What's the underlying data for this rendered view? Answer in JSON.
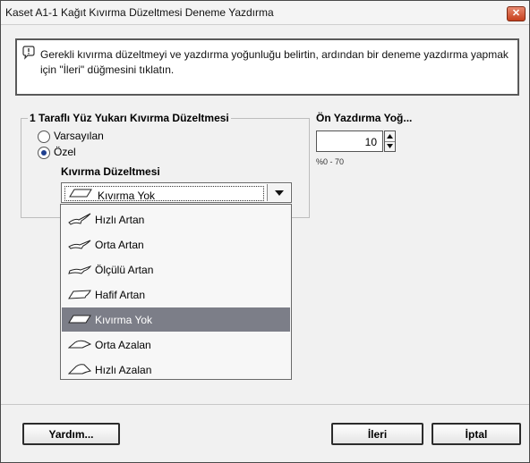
{
  "window": {
    "title": "Kaset A1-1 Kağıt Kıvırma Düzeltmesi Deneme Yazdırma",
    "close_label": "✕"
  },
  "info": {
    "icon": "speech-bubble-info-icon",
    "text": "Gerekli kıvırma düzeltmeyi ve yazdırma yoğunluğu belirtin, ardından bir deneme yazdırma yapmak için \"İleri\" düğmesini tıklatın."
  },
  "curl_group": {
    "title": "1 Taraflı Yüz Yukarı Kıvırma Düzeltmesi",
    "options": [
      {
        "label": "Varsayılan",
        "checked": false
      },
      {
        "label": "Özel",
        "checked": true
      }
    ],
    "sub_label": "Kıvırma Düzeltmesi",
    "selected_value": "Kıvırma Yok",
    "dropdown_items": [
      {
        "label": "Hızlı Artan",
        "icon": "curl-up-strong-icon",
        "selected": false
      },
      {
        "label": "Orta Artan",
        "icon": "curl-up-medium-icon",
        "selected": false
      },
      {
        "label": "Ölçülü Artan",
        "icon": "curl-up-moderate-icon",
        "selected": false
      },
      {
        "label": "Hafif Artan",
        "icon": "curl-up-light-icon",
        "selected": false
      },
      {
        "label": "Kıvırma Yok",
        "icon": "flat-paper-icon",
        "selected": true
      },
      {
        "label": "Orta Azalan",
        "icon": "curl-down-medium-icon",
        "selected": false
      },
      {
        "label": "Hızlı Azalan",
        "icon": "curl-down-strong-icon",
        "selected": false
      }
    ]
  },
  "print_density": {
    "title": "Ön Yazdırma Yoğ...",
    "value": "10",
    "range": "%0 - 70"
  },
  "buttons": {
    "help": "Yardım...",
    "next": "İleri",
    "cancel": "İptal"
  }
}
